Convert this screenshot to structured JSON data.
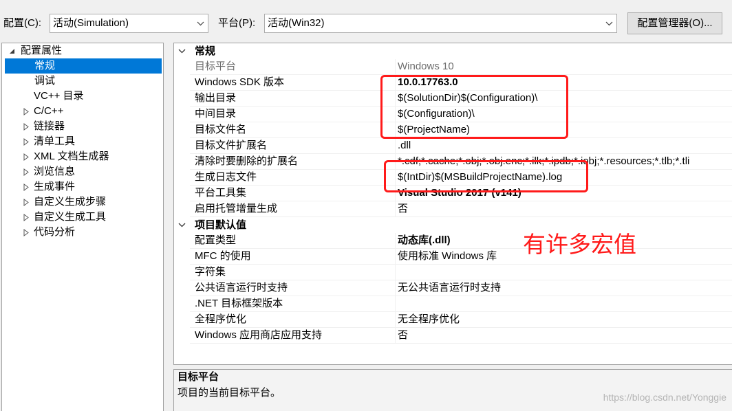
{
  "colors": {
    "dialog_bg": "#f0f0f0",
    "selection_bg": "#0078d7",
    "selection_text": "#ffffff",
    "readonly_text": "#6d6d6d",
    "annotation": "#ff1a1a",
    "watermark": "#b4b4b4"
  },
  "toolbar": {
    "configuration": {
      "label": "配置(C):",
      "value": "活动(Simulation)",
      "icon": "chevron-down-icon"
    },
    "platform": {
      "label": "平台(P):",
      "value": "活动(Win32)",
      "icon": "chevron-down-icon"
    },
    "config_manager_button": "配置管理器(O)..."
  },
  "tree": {
    "root": {
      "label": "配置属性",
      "icon": "expanded-triangle-icon"
    },
    "items": [
      {
        "label": "常规",
        "icon": null
      },
      {
        "label": "调试",
        "icon": null
      },
      {
        "label": "VC++ 目录",
        "icon": null
      },
      {
        "label": "C/C++",
        "icon": "collapsed-triangle-icon"
      },
      {
        "label": "链接器",
        "icon": "collapsed-triangle-icon"
      },
      {
        "label": "清单工具",
        "icon": "collapsed-triangle-icon"
      },
      {
        "label": "XML 文档生成器",
        "icon": "collapsed-triangle-icon"
      },
      {
        "label": "浏览信息",
        "icon": "collapsed-triangle-icon"
      },
      {
        "label": "生成事件",
        "icon": "collapsed-triangle-icon"
      },
      {
        "label": "自定义生成步骤",
        "icon": "collapsed-triangle-icon"
      },
      {
        "label": "自定义生成工具",
        "icon": "collapsed-triangle-icon"
      },
      {
        "label": "代码分析",
        "icon": "collapsed-triangle-icon"
      }
    ]
  },
  "grid": {
    "sections": [
      {
        "title": "常规",
        "icon": "chevron-down-icon",
        "rows": [
          {
            "name": "目标平台",
            "value": "Windows 10"
          },
          {
            "name": "Windows SDK 版本",
            "value": "10.0.17763.0"
          },
          {
            "name": "输出目录",
            "value": "$(SolutionDir)$(Configuration)\\"
          },
          {
            "name": "中间目录",
            "value": "$(Configuration)\\"
          },
          {
            "name": "目标文件名",
            "value": "$(ProjectName)"
          },
          {
            "name": "目标文件扩展名",
            "value": ".dll"
          },
          {
            "name": "清除时要删除的扩展名",
            "value": "*.cdf;*.cache;*.obj;*.obj.enc;*.ilk;*.ipdb;*.iobj;*.resources;*.tlb;*.tli"
          },
          {
            "name": "生成日志文件",
            "value": "$(IntDir)$(MSBuildProjectName).log"
          },
          {
            "name": "平台工具集",
            "value": "Visual Studio 2017 (v141)"
          },
          {
            "name": "启用托管增量生成",
            "value": "否"
          }
        ]
      },
      {
        "title": "项目默认值",
        "icon": "chevron-down-icon",
        "rows": [
          {
            "name": "配置类型",
            "value": "动态库(.dll)"
          },
          {
            "name": "MFC 的使用",
            "value": "使用标准 Windows 库"
          },
          {
            "name": "字符集",
            "value": ""
          },
          {
            "name": "公共语言运行时支持",
            "value": "无公共语言运行时支持"
          },
          {
            "name": ".NET 目标框架版本",
            "value": ""
          },
          {
            "name": "全程序优化",
            "value": "无全程序优化"
          },
          {
            "name": "Windows 应用商店应用支持",
            "value": "否"
          }
        ]
      }
    ]
  },
  "description": {
    "title": "目标平台",
    "text": "项目的当前目标平台。"
  },
  "annotation": {
    "text": "有许多宏值"
  },
  "watermark": "https://blog.csdn.net/Yonggie"
}
